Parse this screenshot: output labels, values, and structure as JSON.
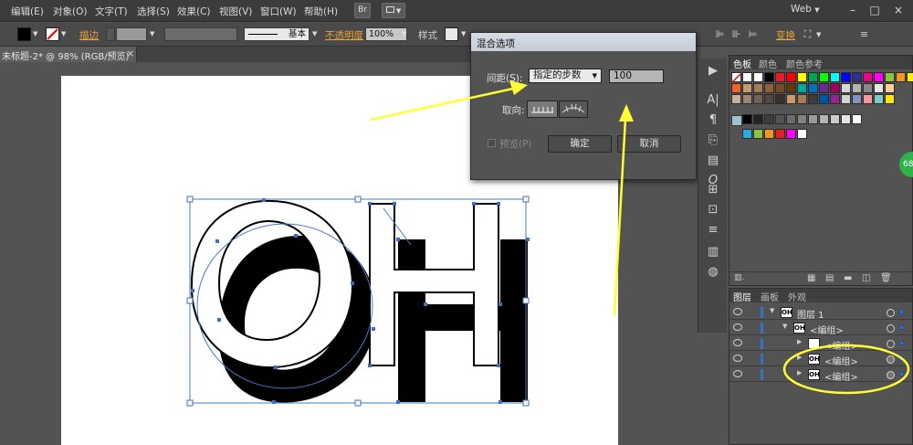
{
  "menubar": {
    "items": [
      "编辑(E)",
      "对象(O)",
      "文字(T)",
      "选择(S)",
      "效果(C)",
      "视图(V)",
      "窗口(W)",
      "帮助(H)"
    ],
    "br_button": "Br",
    "workspace": "Web",
    "min": "–",
    "restore": "□"
  },
  "controlbar": {
    "stroke_label": "描边",
    "opacity_label": "不透明度",
    "opacity_value": "100%",
    "brush_label": "基本",
    "style_label": "样式",
    "transform_label": "变换"
  },
  "document": {
    "tab_title": "未标题-2* @ 98% (RGB/预览)",
    "close": "×"
  },
  "dialog": {
    "title": "混合选项",
    "spacing_label": "间距(S):",
    "spacing_option": "指定的步数",
    "spacing_value": "100",
    "orientation_label": "取向:",
    "preview_label": "预览(P)",
    "ok_label": "确定",
    "cancel_label": "取消"
  },
  "swatches_panel": {
    "tabs": [
      "色板",
      "颜色",
      "颜色参考"
    ],
    "colors_row1": [
      "#ffffff",
      "#000000",
      "#ed1c24",
      "#ff0000",
      "#ffff00",
      "#00a651",
      "#00ff00",
      "#00ffff",
      "#0000ff",
      "#2e3192",
      "#ec008c",
      "#ff00ff",
      "#8dc63f",
      "#f7941d",
      "#fff200"
    ],
    "colors_row2": [
      "#f26522",
      "#c69c6d",
      "#a67c52",
      "#8c6239",
      "#754c24",
      "#603913",
      "#00a99d",
      "#0072bc",
      "#662d91",
      "#9e005d",
      "#d7d7d7",
      "#b3b3b3",
      "#898989",
      "#e6e6e6",
      "#ffcc99"
    ],
    "colors_row3": [
      "#c7b299",
      "#998675",
      "#736357",
      "#534741",
      "#362f2d",
      "#c69c6d",
      "#a67c52",
      "#3d3d3d",
      "#0054a6",
      "#92278f",
      "#d4d4d4",
      "#8393ca",
      "#f5989d",
      "#7accc8",
      "#ffe600"
    ],
    "grays": [
      "#000000",
      "#242424",
      "#3d3d3d",
      "#545454",
      "#6b6b6b",
      "#828282",
      "#9a9a9a",
      "#b3b3b3",
      "#cccccc",
      "#e6e6e6",
      "#ffffff"
    ],
    "group_colors": [
      "#29abe2",
      "#8cc63f",
      "#f7931e",
      "#ed1c24",
      "#ff00ff",
      "#ffffff"
    ]
  },
  "layers_panel": {
    "tabs": [
      "图层",
      "画板",
      "外观"
    ],
    "rows": [
      {
        "name": "图层 1",
        "thumb": "OH"
      },
      {
        "name": "<编组>",
        "thumb": "OH"
      },
      {
        "name": "<编组>",
        "thumb": ""
      },
      {
        "name": "<编组>",
        "thumb": "OH"
      },
      {
        "name": "<编组>",
        "thumb": "OH"
      }
    ]
  },
  "badge": {
    "text": "68"
  },
  "colors": {
    "annotation_yellow": "#ffff33",
    "selection_blue": "#3b6fc2",
    "accent_orange": "#e8a33a"
  },
  "icons": [
    "stroke-none-icon",
    "play-icon",
    "type-icon",
    "paragraph-icon",
    "opentype-icon",
    "align-icon",
    "gradient-icon",
    "eye-icon",
    "target-icon"
  ]
}
